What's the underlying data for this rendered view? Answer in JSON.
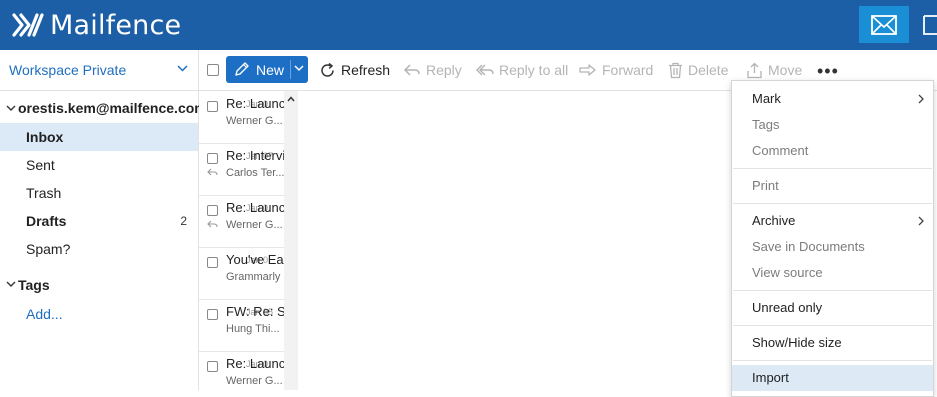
{
  "app": {
    "brand": "Mailfence"
  },
  "sidebar": {
    "workspace": "Workspace Private",
    "account": "orestis.kem@mailfence.com",
    "folders": [
      {
        "label": "Inbox",
        "count": ""
      },
      {
        "label": "Sent",
        "count": ""
      },
      {
        "label": "Trash",
        "count": ""
      },
      {
        "label": "Drafts",
        "count": "2"
      },
      {
        "label": "Spam?",
        "count": ""
      }
    ],
    "tags_label": "Tags",
    "add_label": "Add..."
  },
  "toolbar": {
    "new_label": "New",
    "refresh": "Refresh",
    "reply": "Reply",
    "reply_all": "Reply to all",
    "forward": "Forward",
    "delete": "Delete",
    "move": "Move",
    "more": "•••"
  },
  "messages": [
    {
      "subject": "Re: Launc",
      "date": "Jan 0",
      "sender": "Werner G..."
    },
    {
      "subject": "Re: Intervi",
      "date": "Jan 07",
      "sender": "Carlos Ter..."
    },
    {
      "subject": "Re: Launc",
      "date": "Jan 0",
      "sender": "Werner G..."
    },
    {
      "subject": "You've Ear",
      "date": "Jan 0",
      "sender": "Grammarly"
    },
    {
      "subject": "FW: Re: S",
      "date": "Jan 05",
      "sender": "Hung Thi..."
    },
    {
      "subject": "Re: Launc",
      "date": "Jan 0",
      "sender": "Werner G..."
    }
  ],
  "menu": {
    "mark": "Mark",
    "tags": "Tags",
    "comment": "Comment",
    "print": "Print",
    "archive": "Archive",
    "save_docs": "Save in Documents",
    "view_source": "View source",
    "unread_only": "Unread only",
    "show_hide_size": "Show/Hide size",
    "import": "Import"
  },
  "colors": {
    "brand_bar": "#1c5fa6",
    "accent": "#1c6fc4",
    "selected": "#dce9f6"
  }
}
